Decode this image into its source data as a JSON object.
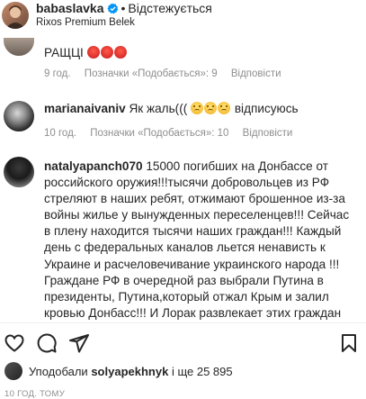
{
  "header": {
    "username": "babaslavka",
    "separator": "•",
    "follow_state": "Відстежується",
    "location": "Rixos Premium Belek"
  },
  "comments": [
    {
      "username": "",
      "text": "РАЩЦІ",
      "emojis": [
        "angry-face",
        "angry-face",
        "angry-face"
      ],
      "age": "9 год.",
      "likes": "Позначки «Подобається»: 9",
      "reply": "Відповісти"
    },
    {
      "username": "marianaivaniv",
      "text": "Як жаль(((",
      "emojis": [
        "sad-face",
        "sad-face",
        "sad-face"
      ],
      "text_after": "відписуюсь",
      "age": "10 год.",
      "likes": "Позначки «Подобається»: 10",
      "reply": "Відповісти"
    },
    {
      "username": "natalyapanch070",
      "text": "15000 погибших на Донбассе от российского оружия!!!тысячи добровольцев из РФ стреляют в наших ребят, отжимают брошенное из-за войны жилье у вынужденных переселенцев!!! Сейчас в плену находится тысячи наших граждан!!! Каждый день с федеральных каналов льется ненависть к Украине и расчеловечивание украинского народа !!!Граждане РФ в очередной раз выбрали Путина в президенты, Путина,который отжал Крым и залил кровью Донбасс!!! И Лорак развлекает этих граждан без тени сомнения!!! Это просто плевок на могилу каждого погибшего воина"
    }
  ],
  "actions": {
    "like_icon": "heart-icon",
    "comment_icon": "comment-icon",
    "share_icon": "share-icon",
    "save_icon": "bookmark-icon"
  },
  "likes": {
    "prefix": "Уподобали",
    "user": "solyapekhnyk",
    "suffix": "і ще 25 895"
  },
  "posted_ago": "10 ГОД. ТОМУ",
  "colors": {
    "text": "#262626",
    "secondary": "#8e8e8e",
    "verified": "#0095f6"
  }
}
